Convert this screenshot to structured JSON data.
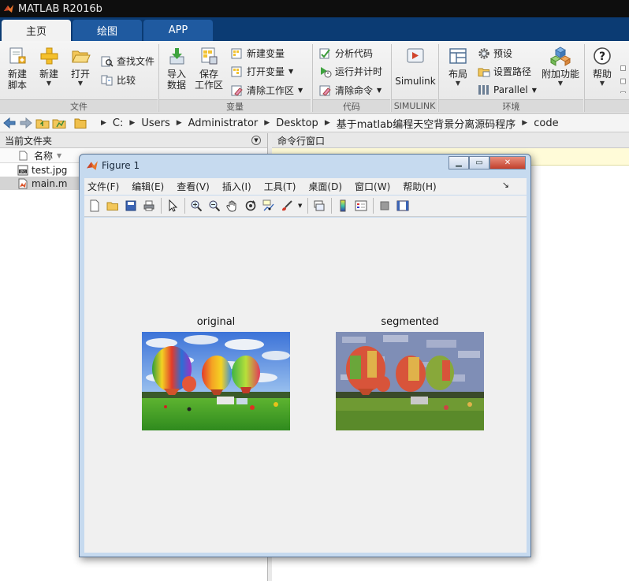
{
  "app": {
    "title": "MATLAB R2016b"
  },
  "tabs": [
    {
      "label": "主页",
      "active": true
    },
    {
      "label": "绘图",
      "active": false
    },
    {
      "label": "APP",
      "active": false
    }
  ],
  "ribbon": {
    "file": {
      "new_script": "新建\n脚本",
      "new": "新建",
      "open": "打开",
      "find_files": "查找文件",
      "compare": "比较",
      "group": "文件"
    },
    "variable": {
      "import": "导入\n数据",
      "save_ws": "保存\n工作区",
      "new_var": "新建变量",
      "open_var": "打开变量",
      "clear_ws": "清除工作区",
      "group": "变量"
    },
    "code": {
      "analyze": "分析代码",
      "run_time": "运行并计时",
      "clear_cmd": "清除命令",
      "group": "代码"
    },
    "simulink": {
      "label": "Simulink",
      "group": "SIMULINK"
    },
    "env": {
      "layout": "布局",
      "prefs": "预设",
      "set_path": "设置路径",
      "parallel": "Parallel",
      "addons": "附加功能",
      "group": "环境"
    },
    "help": {
      "label": "帮助"
    }
  },
  "address": {
    "crumbs": [
      "C:",
      "Users",
      "Administrator",
      "Desktop",
      "基于matlab编程天空背景分离源码程序",
      "code"
    ]
  },
  "current_folder": {
    "title": "当前文件夹",
    "column": "名称",
    "files": [
      {
        "name": "test.jpg",
        "selected": false
      },
      {
        "name": "main.m",
        "selected": true
      }
    ]
  },
  "command_window": {
    "title": "命令行窗口"
  },
  "figure": {
    "title": "Figure 1",
    "menu": [
      "文件(F)",
      "编辑(E)",
      "查看(V)",
      "插入(I)",
      "工具(T)",
      "桌面(D)",
      "窗口(W)",
      "帮助(H)"
    ],
    "images": [
      {
        "title": "original"
      },
      {
        "title": "segmented"
      }
    ]
  },
  "colors": {
    "tab_bar": "#0b3b73",
    "tab_inactive": "#1f5aa0",
    "figure_frame": "#c6daef"
  }
}
